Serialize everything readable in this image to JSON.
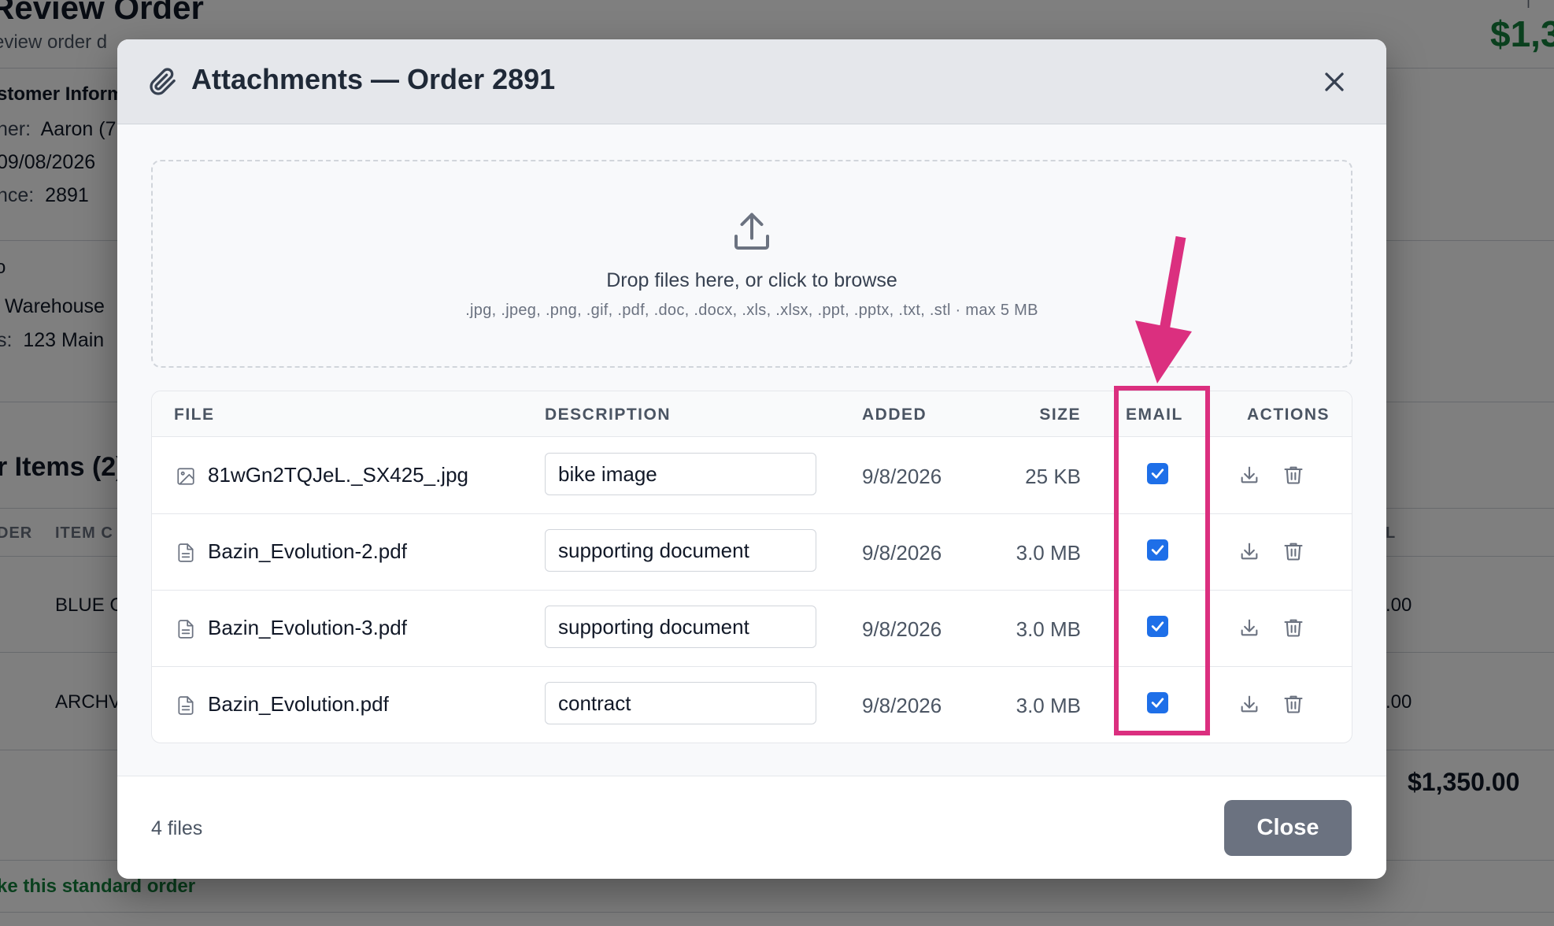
{
  "background": {
    "title": "Review Order",
    "subtitle": "eview order d",
    "total_label": "T",
    "total": "$1,3",
    "customer_section": "stomer Inform",
    "rows": [
      {
        "label": "ner:",
        "value": "Aaron (7"
      },
      {
        "label": "",
        "value": "09/08/2026"
      },
      {
        "label": "nce:",
        "value": "2891"
      }
    ],
    "ship_section": "o",
    "ship_rows": [
      {
        "label": "",
        "value": "Warehouse"
      },
      {
        "label": "s:",
        "value": "123 Main"
      }
    ],
    "items_title": "r Items (2)",
    "col1": "DER",
    "col2": "ITEM C",
    "col3": "L",
    "item1": "BLUE C",
    "item1_amt": ".00",
    "item2": "ARCHV",
    "item2_amt": ".00",
    "grand_total": "$1,350.00",
    "footer_link": "ke this standard order"
  },
  "modal": {
    "title": "Attachments — Order 2891",
    "close_icon": "close-icon",
    "dropzone": {
      "main_text": "Drop files here, or click to browse",
      "sub_text": ".jpg, .jpeg, .png, .gif, .pdf, .doc, .docx, .xls, .xlsx, .ppt, .pptx, .txt, .stl · max 5 MB"
    },
    "columns": {
      "file": "FILE",
      "description": "DESCRIPTION",
      "added": "ADDED",
      "size": "SIZE",
      "email": "EMAIL",
      "actions": "ACTIONS"
    },
    "files": [
      {
        "icon": "image-file-icon",
        "name": "81wGn2TQJeL._SX425_.jpg",
        "description": "bike image",
        "added": "9/8/2026",
        "size": "25 KB",
        "email": true
      },
      {
        "icon": "document-file-icon",
        "name": "Bazin_Evolution-2.pdf",
        "description": "supporting document",
        "added": "9/8/2026",
        "size": "3.0 MB",
        "email": true
      },
      {
        "icon": "document-file-icon",
        "name": "Bazin_Evolution-3.pdf",
        "description": "supporting document",
        "added": "9/8/2026",
        "size": "3.0 MB",
        "email": true
      },
      {
        "icon": "document-file-icon",
        "name": "Bazin_Evolution.pdf",
        "description": "contract",
        "added": "9/8/2026",
        "size": "3.0 MB",
        "email": true
      }
    ],
    "footer": {
      "file_count": "4 files",
      "close_label": "Close"
    }
  },
  "colors": {
    "accent_checkbox": "#1e6fe8",
    "annotation": "#db2f7f",
    "close_button": "#6b7280",
    "total_green": "#15803d"
  }
}
